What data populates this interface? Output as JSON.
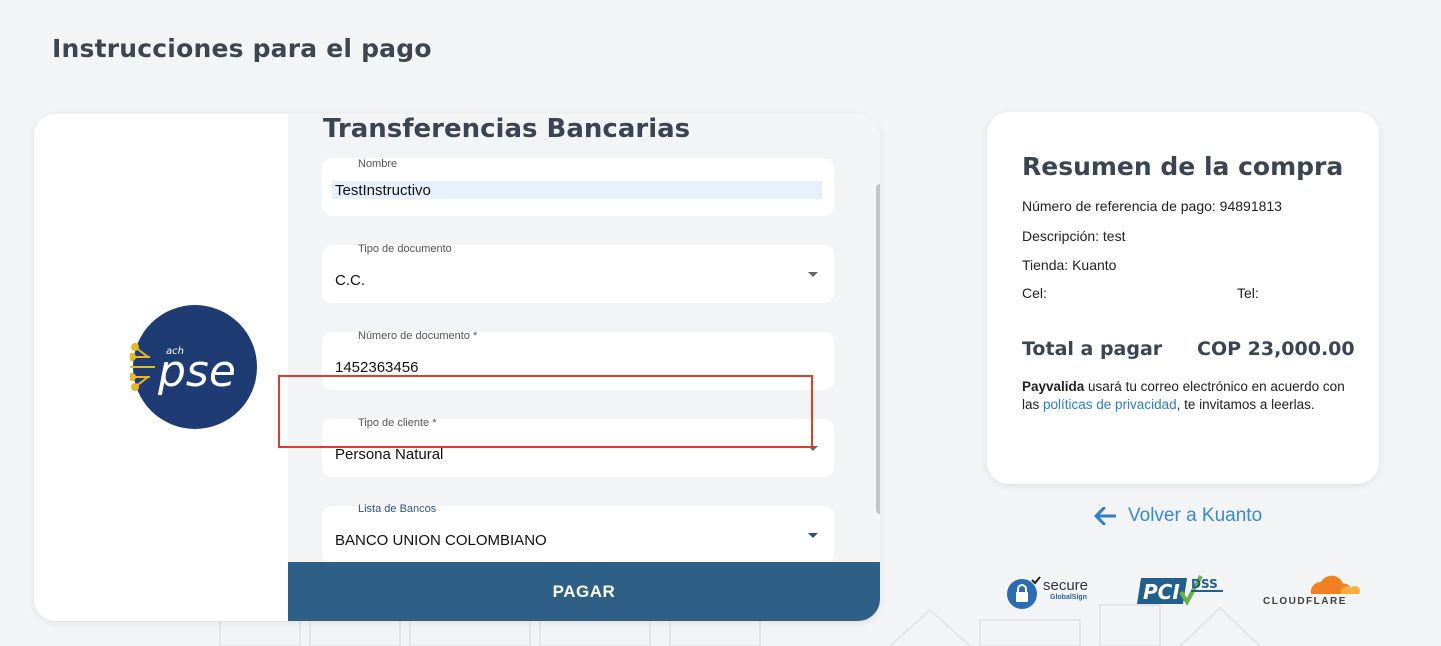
{
  "page": {
    "heading": "Instrucciones para el pago"
  },
  "form": {
    "title": "Transferencias Bancarias",
    "fields": {
      "nombre": {
        "label": "Nombre",
        "value": "TestInstructivo"
      },
      "tipo_documento": {
        "label": "Tipo de documento",
        "value": "C.C."
      },
      "numero_documento": {
        "label": "Número de documento *",
        "value": "1452363456"
      },
      "tipo_cliente": {
        "label": "Tipo de cliente *",
        "value": "Persona Natural"
      },
      "lista_bancos": {
        "label": "Lista de Bancos",
        "value": "BANCO UNION COLOMBIANO"
      }
    },
    "pay_label": "PAGAR"
  },
  "logo": {
    "small": "ach",
    "brand": "pse"
  },
  "summary": {
    "title": "Resumen de la compra",
    "reference": "Número de referencia de pago: 94891813",
    "description": "Descripción: test",
    "store": "Tienda: Kuanto",
    "cel": "Cel:",
    "tel": "Tel:",
    "total_label": "Total a pagar",
    "total_value": "COP 23,000.00",
    "privacy_brand": "Payvalida",
    "privacy_text_1": " usará tu correo electrónico en acuerdo con las ",
    "privacy_link": "políticas de privacidad",
    "privacy_text_2": ", te invitamos a leerlas."
  },
  "back": {
    "label": "Volver a Kuanto"
  },
  "badges": {
    "secure": "secure",
    "secure_sub": "GlobalSign",
    "pci": "PCI",
    "dss": "DSS",
    "cloudflare": "CLOUDFLARE"
  },
  "colors": {
    "accent": "#2d5f87",
    "link": "#3a8ad0",
    "highlight_border": "#e23b2b",
    "pse_blue": "#1f3b73",
    "cloudflare_orange": "#f38020"
  }
}
